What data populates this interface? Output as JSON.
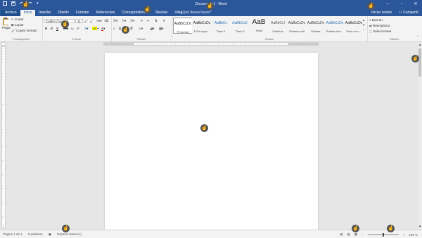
{
  "titlebar": {
    "title": "Documento1 - Word",
    "window_controls": [
      "restore-icon",
      "minimize-icon",
      "maximize-icon",
      "close-icon"
    ]
  },
  "tabs": [
    "Archivo",
    "Inicio",
    "Insertar",
    "Diseño",
    "Formato",
    "Referencias",
    "Correspondencia",
    "Revisar",
    "Vista"
  ],
  "active_tab": "Inicio",
  "tell_me": "¿Qué desea hacer?",
  "account": {
    "sign_in": "Iniciar sesión",
    "share": "Compartir"
  },
  "clipboard": {
    "paste": "Pegar",
    "cut": "Cortar",
    "copy": "Copiar",
    "format_painter": "Copiar formato",
    "label": "Portapapeles"
  },
  "font": {
    "name": "Calibri (Cuerpo)",
    "size": "11",
    "label": "Fuente",
    "buttons": [
      "N",
      "K",
      "S",
      "abc",
      "x₂",
      "x²",
      "A",
      "A"
    ]
  },
  "paragraph": {
    "label": "Párrafo"
  },
  "styles": {
    "label": "Estilos",
    "items": [
      {
        "sample": "AaBbCcDc",
        "name": "¶ Normal"
      },
      {
        "sample": "AaBbCcDc",
        "name": "¶ Sin espa..."
      },
      {
        "sample": "AaBbCc",
        "name": "Título 1"
      },
      {
        "sample": "AaBbCcE",
        "name": "Título 2"
      },
      {
        "sample": "AaB",
        "name": "Título"
      },
      {
        "sample": "AaBbCcI",
        "name": "Subtítulo"
      },
      {
        "sample": "AaBbCcDc",
        "name": "Énfasis sutil"
      },
      {
        "sample": "AaBbCcDc",
        "name": "Énfasis"
      },
      {
        "sample": "AaBbCcDc",
        "name": "Énfasis inte..."
      },
      {
        "sample": "AaBbCcDc",
        "name": "Texto en n..."
      }
    ]
  },
  "editing": {
    "label": "Edición",
    "find": "Buscar",
    "replace": "Reemplazar",
    "select": "Seleccionar"
  },
  "status": {
    "page": "Página 1 de 1",
    "words": "0 palabras",
    "language": "Español (México)",
    "zoom": "100 %"
  },
  "colors": {
    "brand": "#2b579a",
    "ribbon": "#f3f3f3",
    "canvas": "#e6e6e6"
  }
}
